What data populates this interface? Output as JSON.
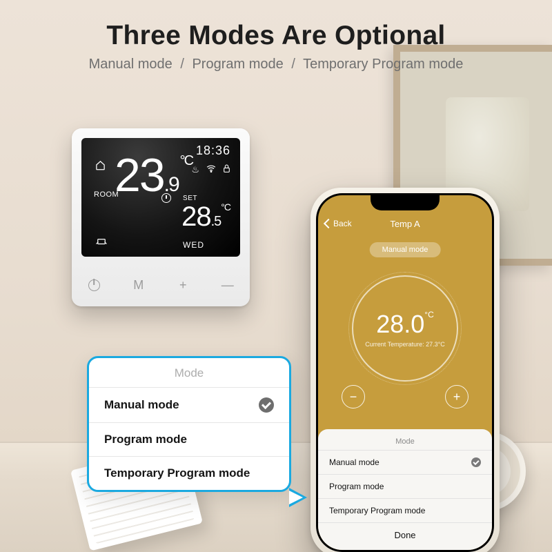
{
  "heading": {
    "title": "Three Modes Are Optional",
    "sub1": "Manual mode",
    "sub2": "Program mode",
    "sub3": "Temporary Program mode"
  },
  "thermostat": {
    "time": "18:36",
    "room_label": "ROOM",
    "room_temp_int": "23",
    "room_temp_dec": ".9",
    "room_temp_unit": "°C",
    "set_label": "SET",
    "set_temp_int": "28",
    "set_temp_dec": ".5",
    "set_temp_unit": "°C",
    "day": "WED",
    "btn_mode": "M",
    "btn_plus": "+",
    "btn_minus": "—"
  },
  "phone": {
    "back": "Back",
    "title": "Temp A",
    "mode_pill": "Manual mode",
    "dial_temp": "28.0",
    "dial_unit": "°C",
    "current_label": "Current Temperature: 27.3°C",
    "sheet_title": "Mode",
    "options": [
      "Manual mode",
      "Program mode",
      "Temporary Program mode"
    ],
    "selected_index": 0,
    "done": "Done"
  },
  "callout": {
    "title": "Mode",
    "options": [
      "Manual mode",
      "Program mode",
      "Temporary Program mode"
    ],
    "selected_index": 0
  }
}
